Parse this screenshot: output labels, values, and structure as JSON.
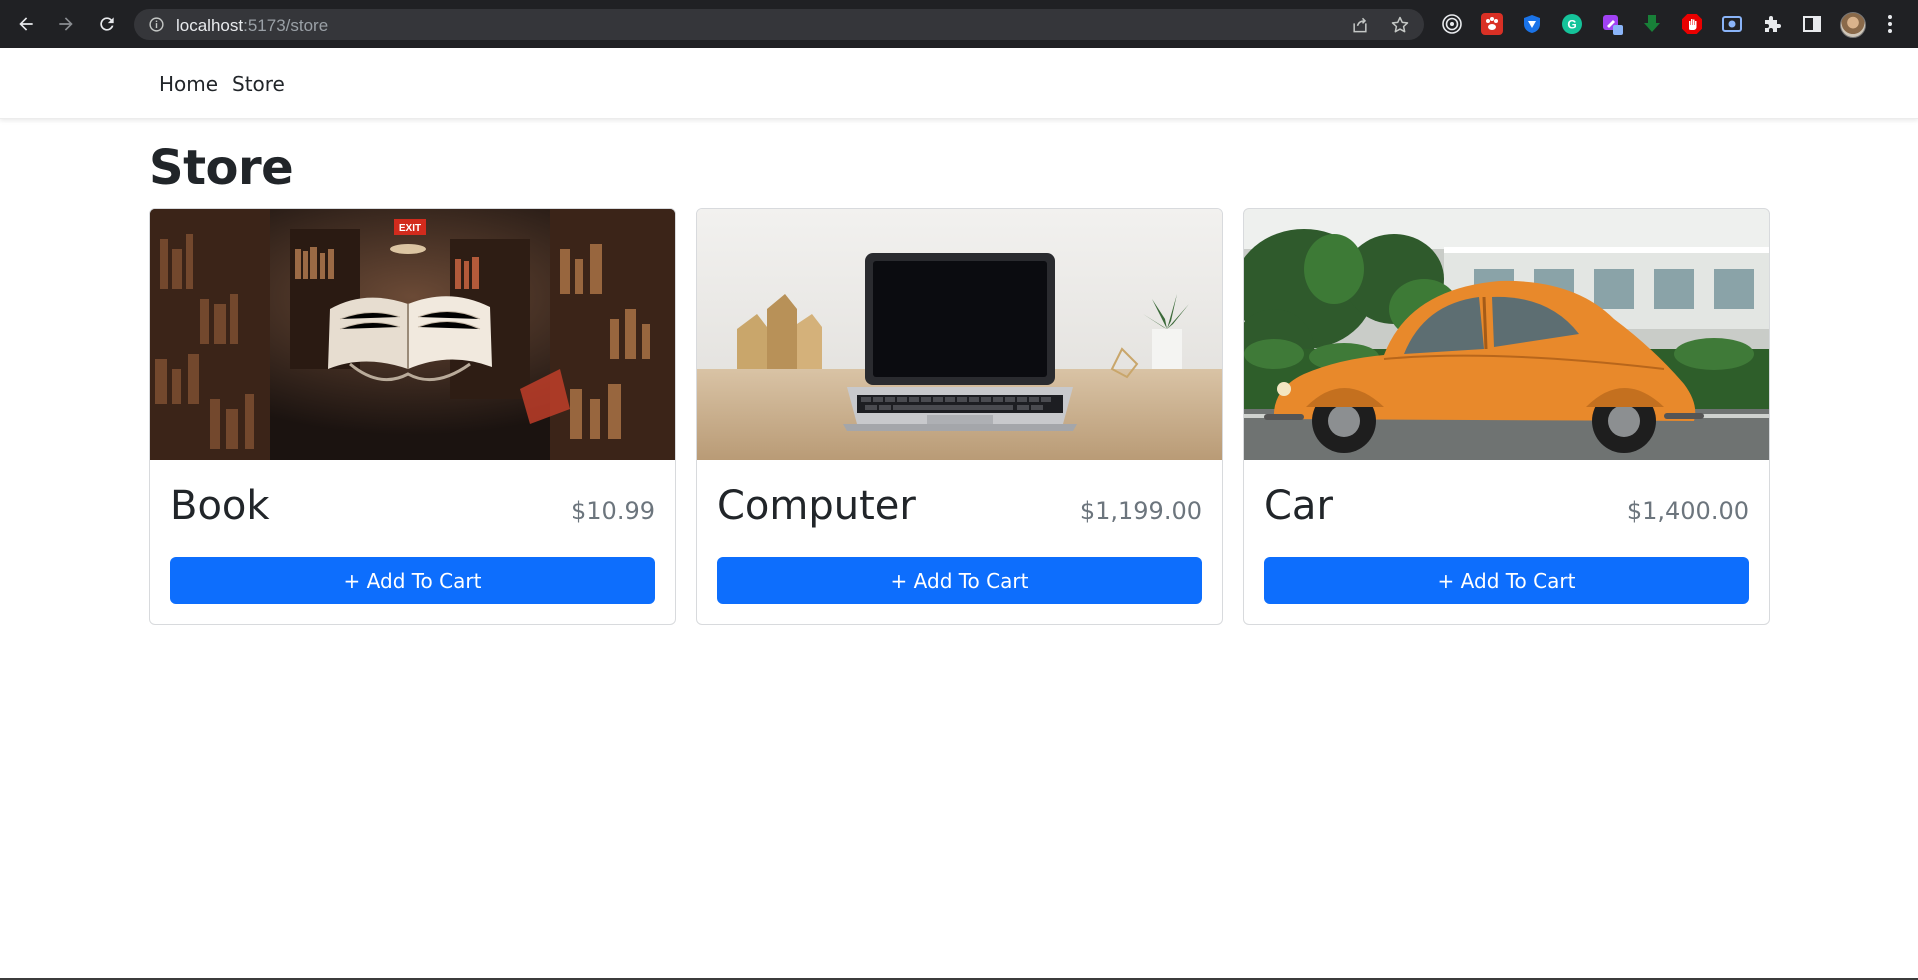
{
  "browser": {
    "url_host": "localhost",
    "url_path": ":5173/store",
    "icons": {
      "back": "arrow-left-icon",
      "forward": "arrow-right-icon",
      "reload": "reload-icon",
      "site_info": "info-icon",
      "share": "share-icon",
      "bookmark": "star-icon",
      "extensions": "puzzle-icon",
      "sidepanel": "side-panel-icon",
      "menu": "kebab-menu-icon"
    }
  },
  "navbar": {
    "links": [
      {
        "label": "Home"
      },
      {
        "label": "Store"
      }
    ]
  },
  "page": {
    "title": "Store"
  },
  "products": [
    {
      "name": "Book",
      "price": "$10.99",
      "button_label": "+ Add To Cart",
      "image": "open-book-library-photo"
    },
    {
      "name": "Computer",
      "price": "$1,199.00",
      "button_label": "+ Add To Cart",
      "image": "laptop-on-desk-photo"
    },
    {
      "name": "Car",
      "price": "$1,400.00",
      "button_label": "+ Add To Cart",
      "image": "orange-beetle-car-photo"
    }
  ],
  "colors": {
    "primary": "#0d6efd",
    "muted": "#6c757d",
    "text": "#212529",
    "chrome": "#202124",
    "omnibox": "#35363a"
  }
}
